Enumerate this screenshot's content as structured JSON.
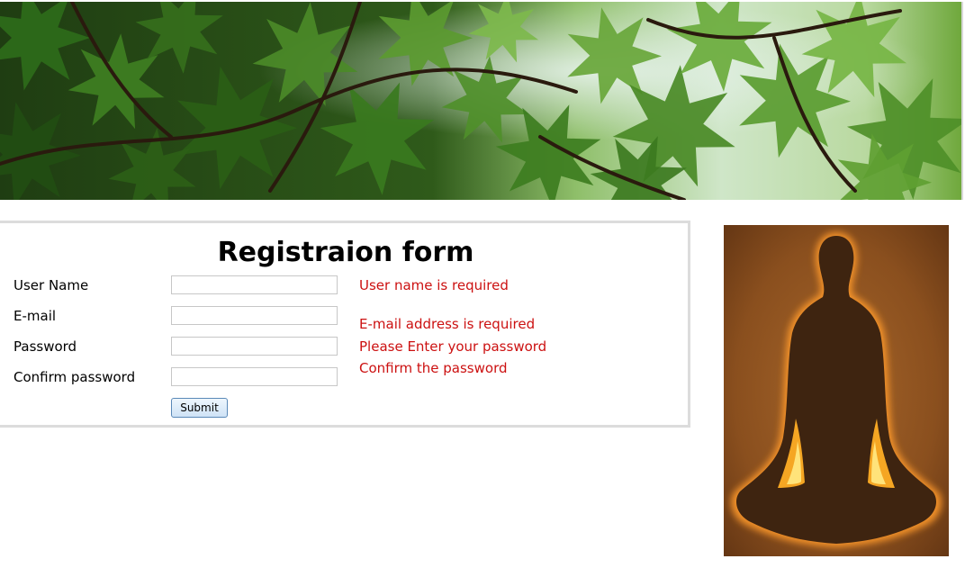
{
  "form": {
    "title": "Registraion form",
    "submit_label": "Submit",
    "fields": [
      {
        "label": "User Name",
        "value": "",
        "error": "User name is required"
      },
      {
        "label": "E-mail",
        "value": "",
        "error": "E-mail address is required"
      },
      {
        "label": "Password",
        "value": "",
        "error": "Please Enter your password"
      },
      {
        "label": "Confirm password",
        "value": "",
        "error": "Confirm the password"
      }
    ]
  },
  "colors": {
    "error": "#cc1111",
    "panel_border": "#dcdcdc",
    "button_border": "#5a89b8"
  },
  "images": {
    "banner": "green-leaves-banner",
    "side": "meditating-silhouette"
  }
}
